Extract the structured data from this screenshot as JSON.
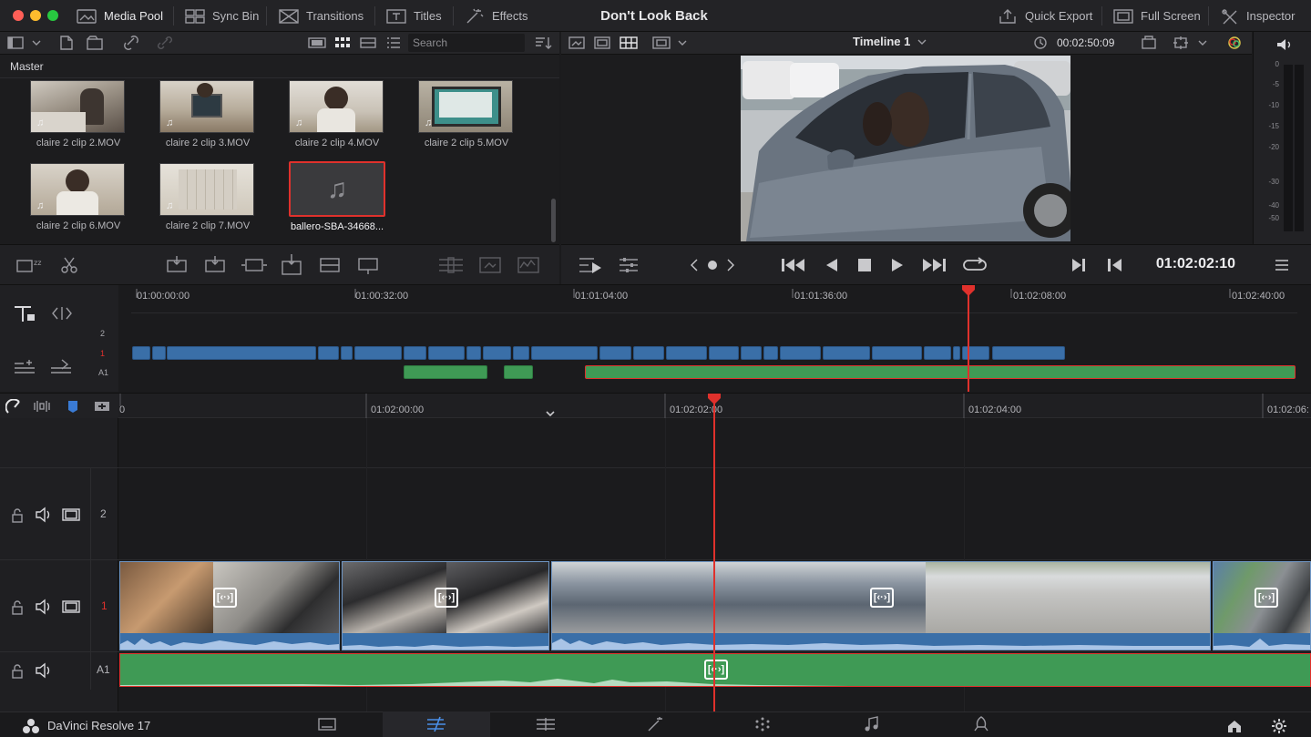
{
  "titlebar": {
    "media_pool": "Media Pool",
    "sync_bin": "Sync Bin",
    "transitions": "Transitions",
    "titles": "Titles",
    "effects": "Effects",
    "project_title": "Don't Look Back",
    "quick_export": "Quick Export",
    "full_screen": "Full Screen",
    "inspector": "Inspector"
  },
  "media_pool": {
    "search_placeholder": "Search",
    "bin_name": "Master",
    "clips": [
      {
        "name": "claire 2 clip 2.MOV",
        "icon": "music-note-icon"
      },
      {
        "name": "claire 2 clip 3.MOV",
        "icon": "music-note-icon"
      },
      {
        "name": "claire 2 clip 4.MOV",
        "icon": "music-note-icon"
      },
      {
        "name": "claire 2 clip 5.MOV",
        "icon": "music-note-icon"
      },
      {
        "name": "claire 2 clip 6.MOV",
        "icon": "music-note-icon"
      },
      {
        "name": "claire 2 clip 7.MOV",
        "icon": "music-note-icon"
      },
      {
        "name": "ballero-SBA-34668...",
        "icon": "music-note-icon",
        "selected": true
      }
    ]
  },
  "viewer": {
    "timeline_name": "Timeline 1",
    "duration": "00:02:50:09",
    "timecode": "01:02:02:10"
  },
  "meters": {
    "labels": [
      "0",
      "-5",
      "-10",
      "-15",
      "-20",
      "-30",
      "-40",
      "-50"
    ]
  },
  "upper_timeline": {
    "ruler": [
      "01:00:00:00",
      "01:00:32:00",
      "01:01:04:00",
      "01:01:36:00",
      "01:02:08:00",
      "01:02:40:00"
    ],
    "tracks": [
      "2",
      "1",
      "A1"
    ]
  },
  "lower_timeline": {
    "ruler": [
      "0",
      "01:02:00:00",
      "01:02:02:00",
      "01:02:04:00",
      "01:02:06:"
    ],
    "tracks": [
      {
        "label": "2",
        "type": "video"
      },
      {
        "label": "1",
        "type": "video"
      },
      {
        "label": "A1",
        "type": "audio"
      }
    ],
    "fx_badge": "[‹·›]"
  },
  "bottom": {
    "app_name": "DaVinci Resolve 17",
    "pages": [
      "media-page-icon",
      "cut-page-icon",
      "edit-page-icon",
      "fusion-page-icon",
      "color-page-icon",
      "fairlight-page-icon",
      "deliver-page-icon"
    ]
  },
  "colors": {
    "playhead": "#e0312c",
    "video_clip": "#3a6fa8",
    "audio_clip": "#3f9a55",
    "selected_border": "#e0312c"
  }
}
